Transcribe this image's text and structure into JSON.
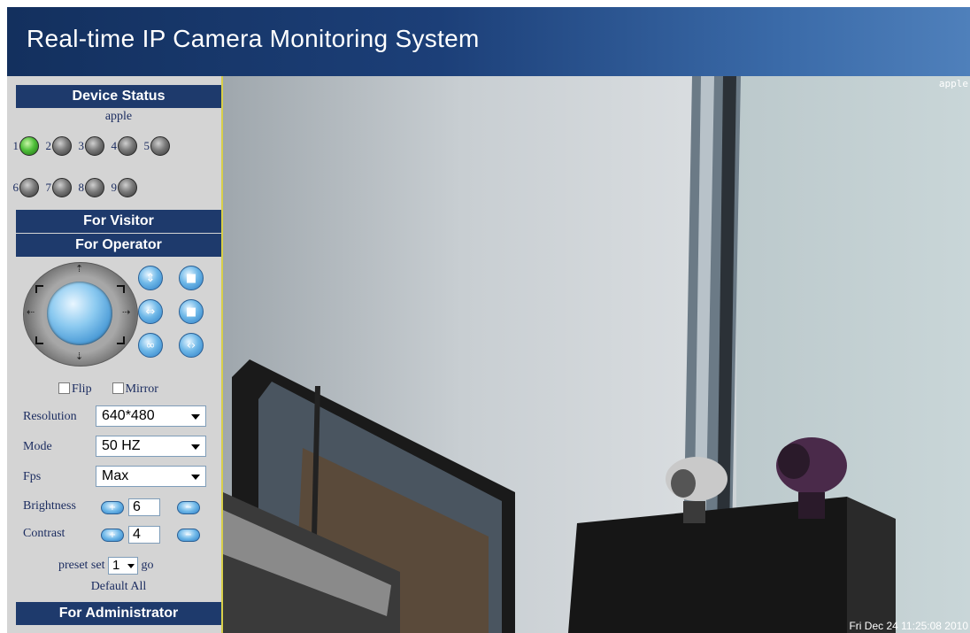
{
  "header": {
    "title": "Real-time IP Camera Monitoring System"
  },
  "sidebar": {
    "device_status_label": "Device Status",
    "device_name": "apple",
    "indicators": [
      {
        "num": "1",
        "on": true
      },
      {
        "num": "2",
        "on": false
      },
      {
        "num": "3",
        "on": false
      },
      {
        "num": "4",
        "on": false
      },
      {
        "num": "5",
        "on": false
      },
      {
        "num": "6",
        "on": false
      },
      {
        "num": "7",
        "on": false
      },
      {
        "num": "8",
        "on": false
      },
      {
        "num": "9",
        "on": false
      }
    ],
    "for_visitor_label": "For Visitor",
    "for_operator_label": "For Operator",
    "flip_label": "Flip",
    "mirror_label": "Mirror",
    "resolution_label": "Resolution",
    "resolution_value": "640*480",
    "mode_label": "Mode",
    "mode_value": "50 HZ",
    "fps_label": "Fps",
    "fps_value": "Max",
    "brightness_label": "Brightness",
    "brightness_value": "6",
    "contrast_label": "Contrast",
    "contrast_value": "4",
    "preset_label": "preset set",
    "preset_value": "1",
    "go_label": "go",
    "default_all_label": "Default All",
    "for_administrator_label": "For Administrator"
  },
  "video": {
    "camera_name": "apple",
    "timestamp": "Fri Dec 24 11:25:08 2010"
  },
  "colors": {
    "header_dark": "#13305e",
    "header_light": "#4f80bb",
    "section_bar": "#1e3a6c",
    "sidebar_bg": "#d4d4d4",
    "led_on": "#4fbf3a",
    "video_border": "#d8cf4a"
  }
}
